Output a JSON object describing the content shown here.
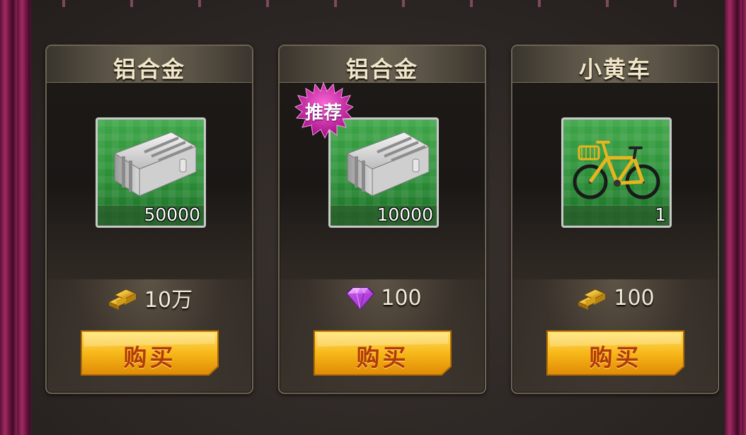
{
  "shop": {
    "items": [
      {
        "title": "铝合金",
        "item_icon": "aluminum-alloy-icon",
        "quantity": "50000",
        "currency_icon": "gold-bars-icon",
        "price": "10万",
        "buy_label": "购买"
      },
      {
        "title": "铝合金",
        "item_icon": "aluminum-alloy-icon",
        "badge": "推荐",
        "quantity": "10000",
        "currency_icon": "diamond-icon",
        "price": "100",
        "buy_label": "购买"
      },
      {
        "title": "小黄车",
        "item_icon": "yellow-bicycle-icon",
        "quantity": "1",
        "currency_icon": "gold-bars-icon",
        "price": "100",
        "buy_label": "购买"
      }
    ]
  },
  "colors": {
    "title_text": "#f3e6c8",
    "item_bg_green": "#2b8f37",
    "buy_button_gold": "#f3b21a",
    "buy_label": "#b23a08",
    "badge_magenta": "#c8109a",
    "curtain": "#a32a63"
  }
}
